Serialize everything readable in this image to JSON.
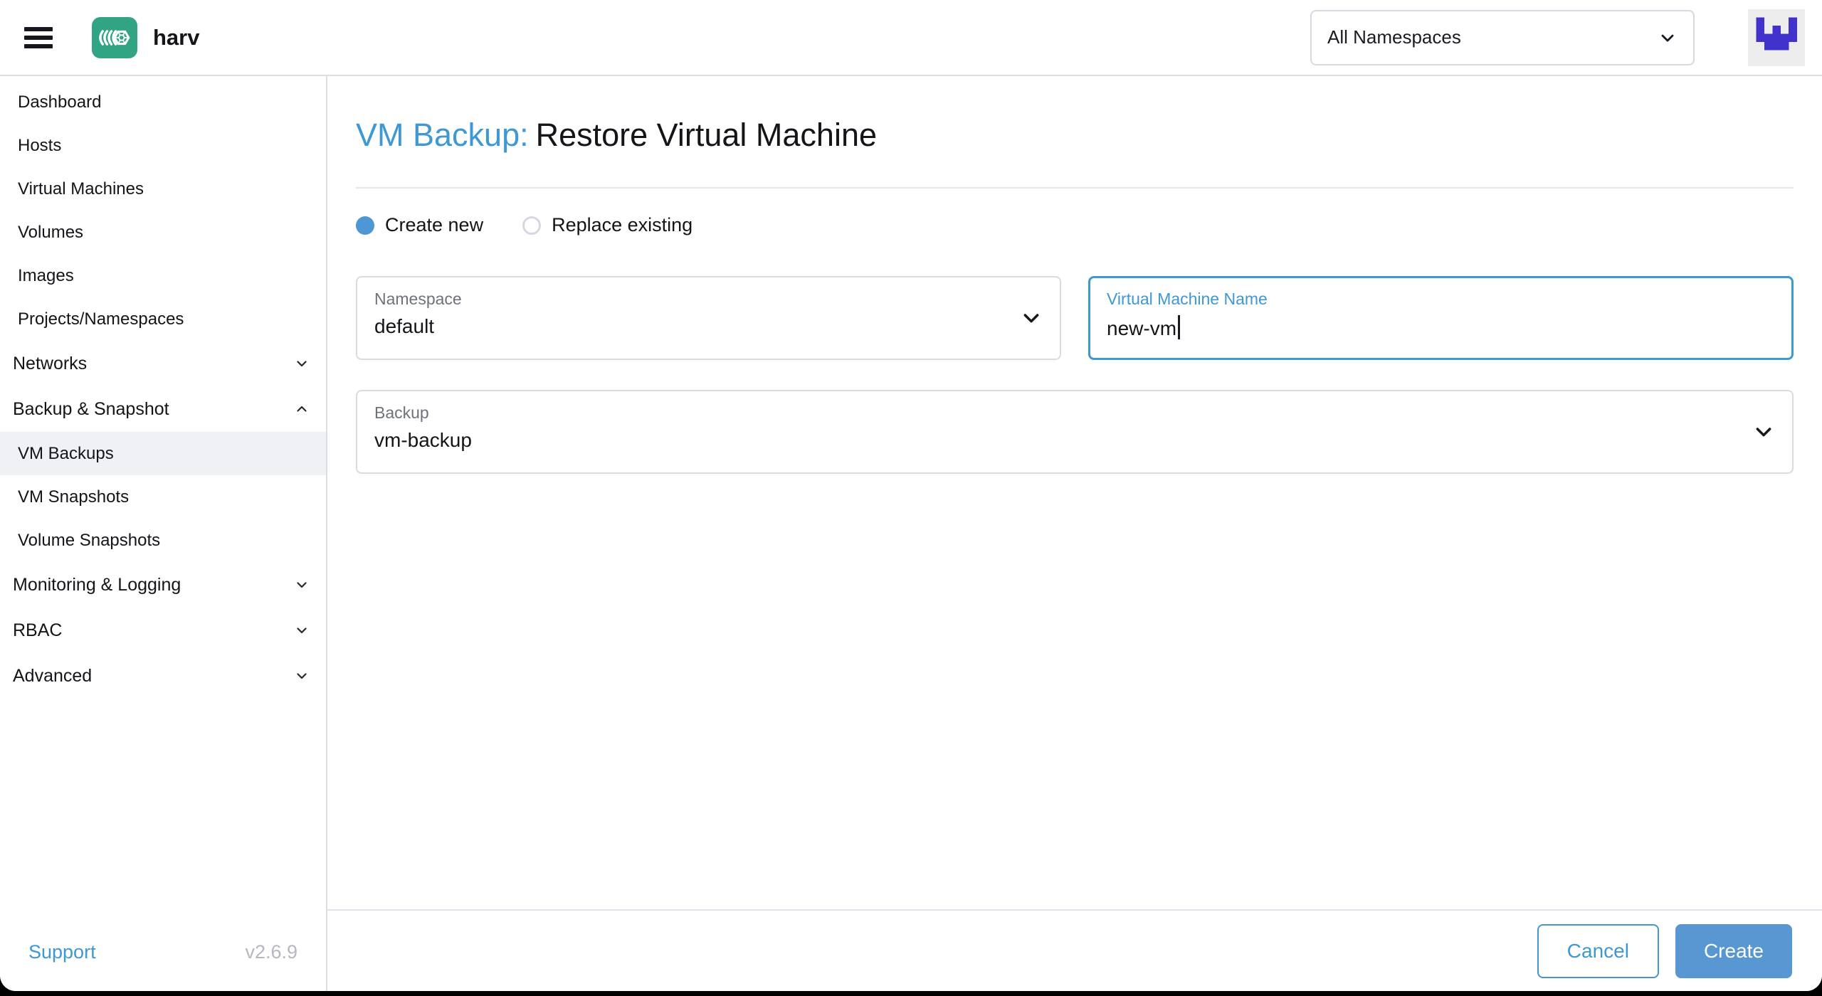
{
  "header": {
    "brand": "harv",
    "namespace_filter": "All Namespaces"
  },
  "sidebar": {
    "items": [
      {
        "label": "Dashboard",
        "type": "link",
        "selected": false
      },
      {
        "label": "Hosts",
        "type": "link",
        "selected": false
      },
      {
        "label": "Virtual Machines",
        "type": "link",
        "selected": false
      },
      {
        "label": "Volumes",
        "type": "link",
        "selected": false
      },
      {
        "label": "Images",
        "type": "link",
        "selected": false
      },
      {
        "label": "Projects/Namespaces",
        "type": "link",
        "selected": false
      },
      {
        "label": "Networks",
        "type": "group",
        "state": "collapsed"
      },
      {
        "label": "Backup & Snapshot",
        "type": "group",
        "state": "expanded"
      },
      {
        "label": "VM Backups",
        "type": "child",
        "selected": true
      },
      {
        "label": "VM Snapshots",
        "type": "child",
        "selected": false
      },
      {
        "label": "Volume Snapshots",
        "type": "child",
        "selected": false
      },
      {
        "label": "Monitoring & Logging",
        "type": "group",
        "state": "collapsed"
      },
      {
        "label": "RBAC",
        "type": "group",
        "state": "collapsed"
      },
      {
        "label": "Advanced",
        "type": "group",
        "state": "collapsed"
      }
    ],
    "footer": {
      "support_label": "Support",
      "version": "v2.6.9"
    }
  },
  "main": {
    "title_prefix": "VM Backup:",
    "title_name": "Restore Virtual Machine",
    "restore_mode_options": [
      {
        "label": "Create new",
        "selected": true
      },
      {
        "label": "Replace existing",
        "selected": false
      }
    ],
    "fields": {
      "namespace": {
        "label": "Namespace",
        "value": "default",
        "type": "select"
      },
      "vm_name": {
        "label": "Virtual Machine Name",
        "value": "new-vm",
        "type": "text",
        "focused": true
      },
      "backup": {
        "label": "Backup",
        "value": "vm-backup",
        "type": "select"
      }
    },
    "actions": {
      "cancel_label": "Cancel",
      "create_label": "Create"
    }
  },
  "colors": {
    "accent": "#3d98d3",
    "primary_button_bg": "#5897d1",
    "radio_selected": "#4f97d4",
    "text": "#141419",
    "field_label_muted": "#6f727b",
    "version_muted": "#b7b7c2",
    "border": "#dcdee7",
    "selected_row_bg": "#f0f1f4",
    "logo_green": "#31a583",
    "avatar_purple": "#4232cd",
    "avatar_bg": "#ededee"
  },
  "icons": {
    "menu": "hamburger-icon",
    "brand": "harvester-logo-icon",
    "namespace_filter": "chevron-down-icon",
    "avatar": "pixel-identicon",
    "group_collapsed": "chevron-down-icon",
    "group_expanded": "chevron-up-icon",
    "select": "chevron-down-icon"
  }
}
